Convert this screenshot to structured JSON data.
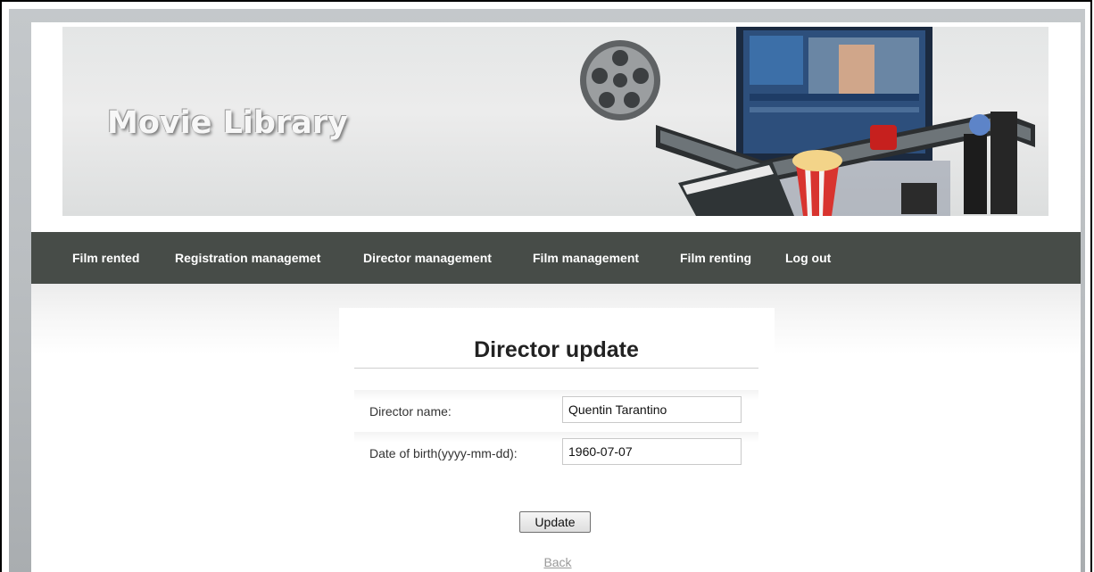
{
  "banner": {
    "title": "Movie Library"
  },
  "nav": {
    "items": [
      {
        "label": "Film rented"
      },
      {
        "label": "Registration managemet"
      },
      {
        "label": "Director management"
      },
      {
        "label": "Film management"
      },
      {
        "label": "Film renting"
      },
      {
        "label": "Log out"
      }
    ]
  },
  "form": {
    "heading": "Director update",
    "fields": [
      {
        "label": "Director name:",
        "value": "Quentin Tarantino"
      },
      {
        "label": "Date of birth(yyyy-mm-dd):",
        "value": "1960-07-07"
      }
    ],
    "submit_label": "Update",
    "back_label": "Back"
  },
  "colors": {
    "nav_background": "#474c48",
    "nav_text": "#ffffff",
    "page_background": "#ffffff",
    "frame_background": "#b9bdc0"
  }
}
